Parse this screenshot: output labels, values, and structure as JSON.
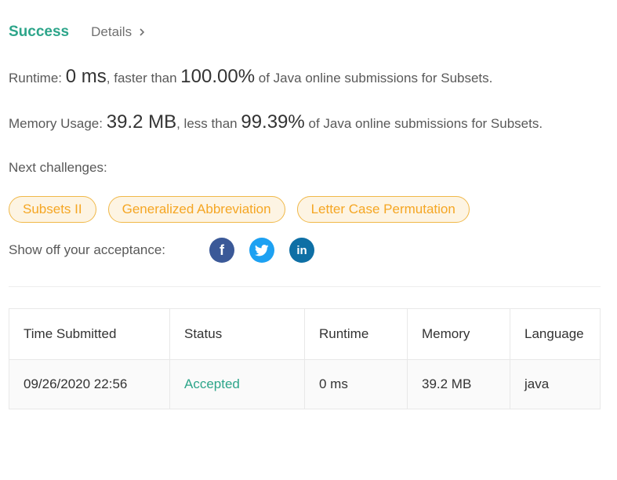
{
  "header": {
    "status": "Success",
    "details": "Details"
  },
  "runtime": {
    "label": "Runtime:",
    "value": "0 ms",
    "comparison": ", faster than",
    "percent": "100.00%",
    "suffix": "of Java online submissions for Subsets."
  },
  "memory": {
    "label": "Memory Usage:",
    "value": "39.2 MB",
    "comparison": ", less than",
    "percent": "99.39%",
    "suffix": "of Java online submissions for Subsets."
  },
  "next": {
    "label": "Next challenges:",
    "challenges": [
      "Subsets II",
      "Generalized Abbreviation",
      "Letter Case Permutation"
    ]
  },
  "share": {
    "label": "Show off your acceptance:",
    "icons": [
      "facebook-icon",
      "twitter-icon",
      "linkedin-icon"
    ]
  },
  "table": {
    "headers": [
      "Time Submitted",
      "Status",
      "Runtime",
      "Memory",
      "Language"
    ],
    "rows": [
      [
        "09/26/2020 22:56",
        "Accepted",
        "0 ms",
        "39.2 MB",
        "java"
      ]
    ]
  },
  "colors": {
    "success": "#2da58a",
    "tag_text": "#f5a623",
    "tag_bg": "#fdf4e3",
    "facebook": "#3b5998",
    "twitter": "#1da1f2",
    "linkedin": "#0e6fa5"
  }
}
